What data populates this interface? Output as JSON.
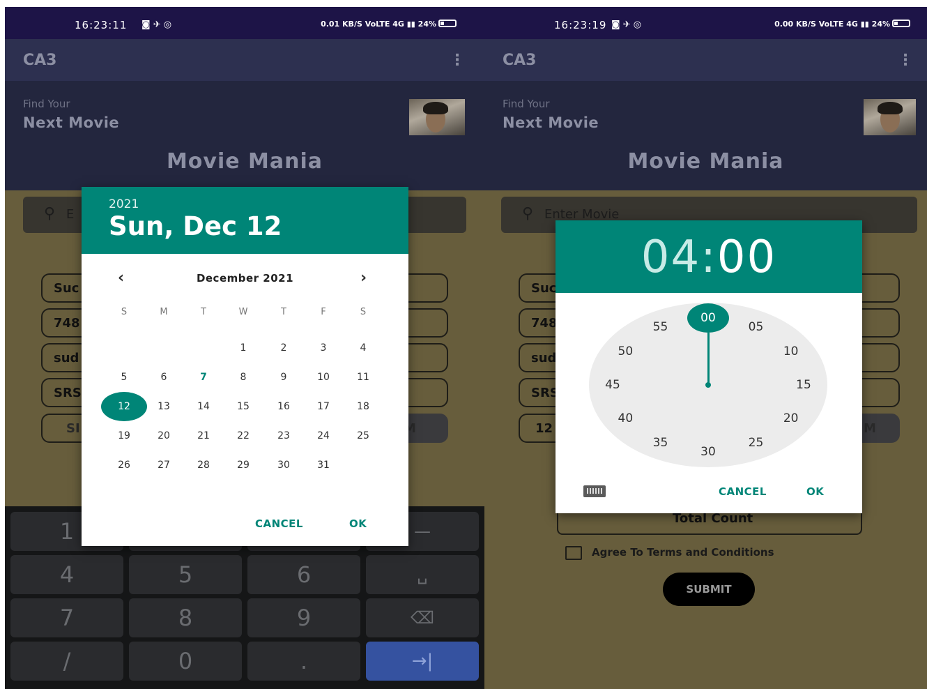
{
  "left": {
    "status": {
      "time": "16:23:11",
      "icons": "◙ ✈ ◎",
      "right": "0.01 KB/S  VoLTE  4G ▮▮  24%"
    },
    "appbar": {
      "title": "CA3",
      "menu": "⋮"
    },
    "hero": {
      "find_label": "Find Your",
      "next_label": "Next Movie",
      "brand": "Movie Mania"
    },
    "search": {
      "icon": "search-icon",
      "partial_text": "E"
    },
    "fields": [
      "Suc",
      "748",
      "sud",
      "SRS",
      "SI"
    ],
    "keyboard": {
      "keys": [
        "1",
        "",
        "",
        "—",
        "4",
        "5",
        "6",
        "␣",
        "7",
        "8",
        "9",
        "⌫",
        "/",
        "0",
        ".",
        "→|"
      ]
    },
    "datepicker": {
      "year": "2021",
      "selected_date": "Sun, Dec 12",
      "month_label": "December 2021",
      "prev": "‹",
      "next": "›",
      "weekdays": [
        "S",
        "M",
        "T",
        "W",
        "T",
        "F",
        "S"
      ],
      "first_weekday_index": 3,
      "days_in_month": 31,
      "today": 7,
      "selected": 12,
      "cancel": "CANCEL",
      "ok": "OK"
    }
  },
  "right": {
    "status": {
      "time": "16:23:19",
      "icons": "◙ ✈ ◎",
      "right": "0.00 KB/S  VoLTE  4G ▮▮  24%"
    },
    "appbar": {
      "title": "CA3",
      "menu": "⋮"
    },
    "hero": {
      "find_label": "Find Your",
      "next_label": "Next Movie",
      "brand": "Movie Mania"
    },
    "search": {
      "icon": "search-icon",
      "placeholder": "Enter Movie"
    },
    "fields": [
      "Suc",
      "748",
      "sud",
      "SRS",
      "12"
    ],
    "timepicker": {
      "hours": "04",
      "separator": ":",
      "minutes": "00",
      "selected_minute": "00",
      "dial": [
        "00",
        "05",
        "10",
        "15",
        "20",
        "25",
        "30",
        "35",
        "40",
        "45",
        "50",
        "55"
      ],
      "keyboard_icon": "keyboard-icon",
      "cancel": "CANCEL",
      "ok": "OK"
    },
    "total_count": "Total Count",
    "agree_label": "Agree To Terms and Conditions",
    "submit_label": "SUBMIT"
  }
}
